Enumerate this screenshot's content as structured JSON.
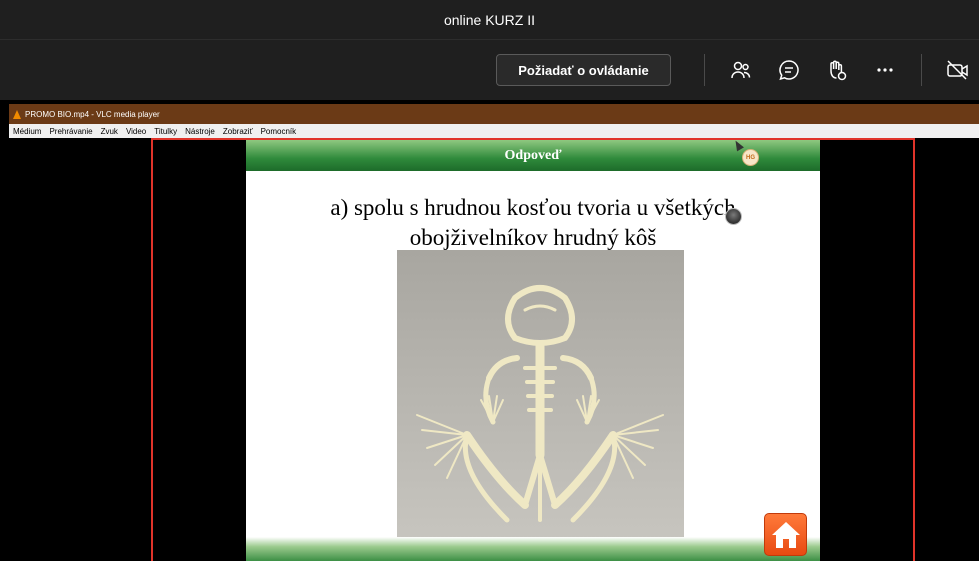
{
  "window": {
    "title": "online KURZ II"
  },
  "toolbar": {
    "request_control_label": "Požiadať o ovládanie",
    "icons": [
      "people-icon",
      "chat-icon",
      "raise-hand-icon",
      "more-icon",
      "camera-off-icon"
    ]
  },
  "vlc": {
    "title": "PROMO BIO.mp4 - VLC media player",
    "menu": [
      "Médium",
      "Prehrávanie",
      "Zvuk",
      "Video",
      "Titulky",
      "Nástroje",
      "Zobraziť",
      "Pomocník"
    ]
  },
  "slide": {
    "header": "Odpoveď",
    "avatar_initials": "HG",
    "answer_line1": "a)   spolu s hrudnou kosťou tvoria u všetkých",
    "answer_line2": "obojživelníkov hrudný kôš",
    "image_subject": "frog skeleton photo"
  },
  "colors": {
    "app_bg": "#1f1f1f",
    "vlc_titlebar": "#6b3a16",
    "share_frame": "#e0342a",
    "slide_green": "#2f8a3b",
    "home_button": "#e84a12"
  }
}
